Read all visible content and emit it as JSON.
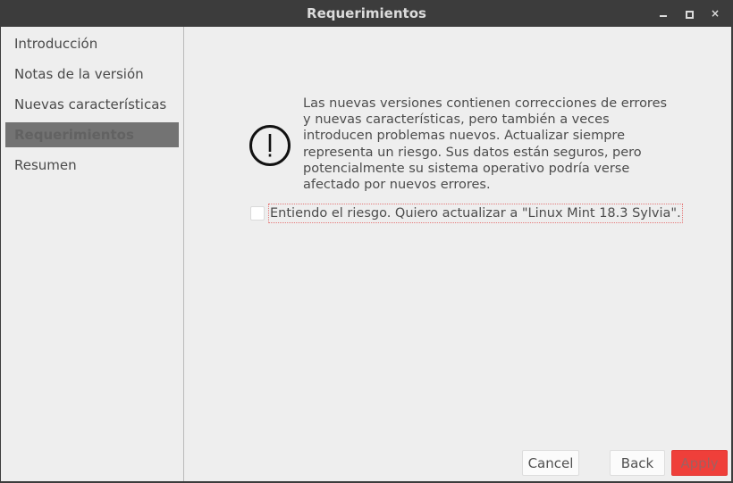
{
  "window": {
    "title": "Requerimientos",
    "controls": {
      "minimize": "minimize",
      "maximize": "maximize",
      "close": "×"
    }
  },
  "sidebar": {
    "items": [
      {
        "label": "Introducción",
        "selected": false
      },
      {
        "label": "Notas de la versión",
        "selected": false
      },
      {
        "label": "Nuevas características",
        "selected": false
      },
      {
        "label": "Requerimientos",
        "selected": true
      },
      {
        "label": "Resumen",
        "selected": false
      }
    ]
  },
  "main": {
    "icon": "warning-exclamation-icon",
    "message": "Las nuevas versiones contienen correcciones de errores\ny nuevas características, pero también a veces\nintroducen problemas nuevos. Actualizar siempre\nrepresenta un riesgo. Sus datos están seguros, pero\npotencialmente su sistema operativo podría verse\nafectado por nuevos errores.",
    "agree_checkbox": {
      "label": "Entiendo el riesgo. Quiero actualizar a \"Linux Mint 18.3 Sylvia\".",
      "checked": false
    }
  },
  "buttons": {
    "cancel": "Cancel",
    "back": "Back",
    "apply": "Apply"
  },
  "colors": {
    "titlebar": "#3c3c3c",
    "background": "#eeeeee",
    "selected_item": "#737373",
    "apply_button": "#ef3f3a"
  }
}
